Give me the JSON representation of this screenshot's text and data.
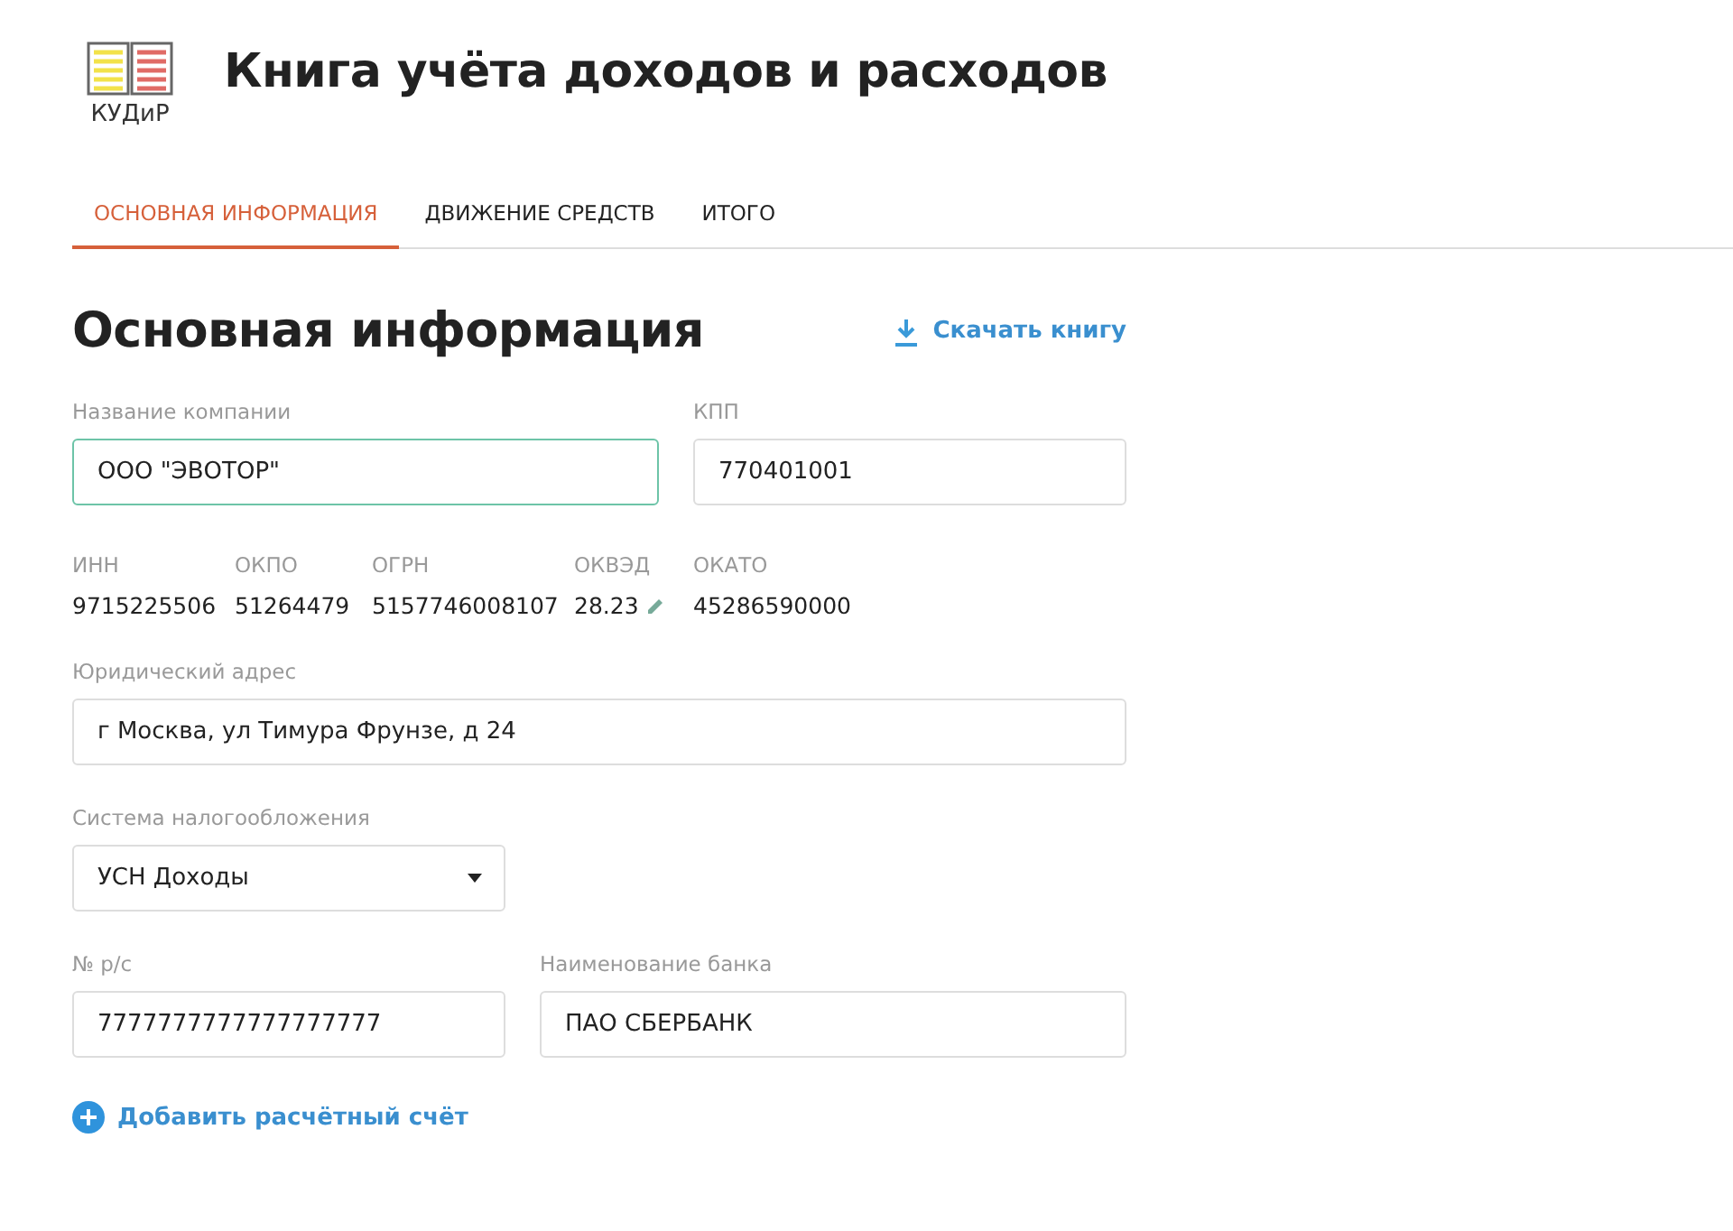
{
  "app": {
    "logo_label": "КУДиР",
    "title": "Книга учёта доходов и расходов"
  },
  "tabs": [
    {
      "label": "ОСНОВНАЯ ИНФОРМАЦИЯ",
      "selected": true
    },
    {
      "label": "ДВИЖЕНИЕ СРЕДСТВ",
      "selected": false
    },
    {
      "label": "ИТОГО",
      "selected": false
    }
  ],
  "section": {
    "title": "Основная информация",
    "download_link": "Скачать книгу"
  },
  "company": {
    "label": "Название компании",
    "value": "ООО \"ЭВОТОР\"",
    "focused": true
  },
  "kpp": {
    "label": "КПП",
    "value": "770401001",
    "focused": false
  },
  "codes": [
    {
      "label": "ИНН",
      "value": "9715225506",
      "editable": false
    },
    {
      "label": "ОКПО",
      "value": "51264479",
      "editable": false
    },
    {
      "label": "ОГРН",
      "value": "5157746008107",
      "editable": false
    },
    {
      "label": "ОКВЭД",
      "value": "28.23",
      "editable": true
    },
    {
      "label": "ОКАТО",
      "value": "45286590000",
      "editable": false
    }
  ],
  "address": {
    "label": "Юридический адрес",
    "value": "г Москва, ул Тимура Фрунзе, д 24",
    "focused": false
  },
  "tax_system": {
    "label": "Система налогообложения",
    "value": "УСН Доходы"
  },
  "account": {
    "label": "№ р/с",
    "value": "7777777777777777777",
    "focused": false
  },
  "bank": {
    "label": "Наименование банка",
    "value": "ПАО СБЕРБАНК",
    "focused": false
  },
  "add_account_link": "Добавить расчётный счёт"
}
